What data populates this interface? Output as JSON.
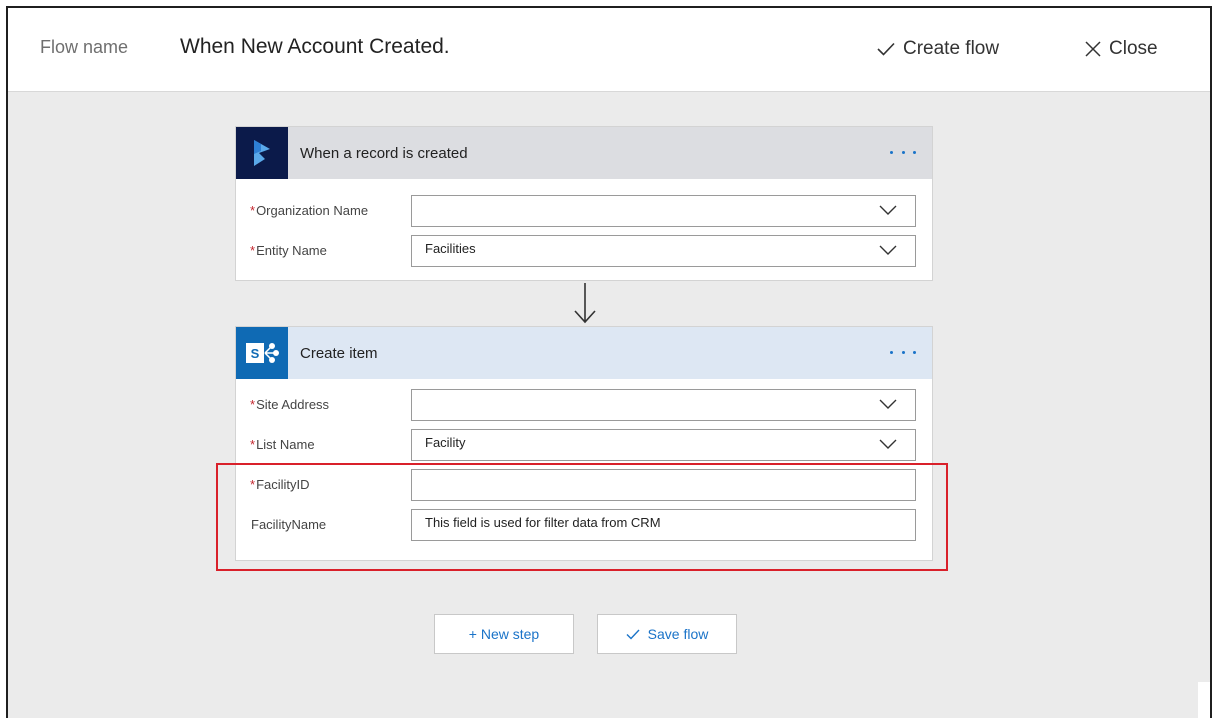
{
  "header": {
    "flow_name_label": "Flow name",
    "flow_name_value": "When New Account Created.",
    "create_flow_label": "Create flow",
    "close_label": "Close"
  },
  "trigger_card": {
    "title": "When a record is created",
    "icon": "dynamics-icon",
    "fields": [
      {
        "label": "Organization Name",
        "required": "*",
        "value": ""
      },
      {
        "label": "Entity Name",
        "required": "*",
        "value": "Facilities"
      }
    ]
  },
  "action_card": {
    "title": "Create item",
    "icon": "sharepoint-icon",
    "fields": [
      {
        "label": "Site Address",
        "required": "*",
        "value": ""
      },
      {
        "label": "List Name",
        "required": "*",
        "value": "Facility"
      },
      {
        "label": "FacilityID",
        "required": "*",
        "value": ""
      },
      {
        "label": "FacilityName",
        "required": "",
        "value": "This field is used for filter data from CRM"
      }
    ]
  },
  "footer": {
    "new_step_label": "+ New step",
    "save_flow_label": "Save flow"
  },
  "colors": {
    "accent": "#1a73c8",
    "required": "#c4262e",
    "highlight": "#d9202a",
    "trigger_icon_bg": "#0b1a4a",
    "action_icon_bg": "#0f6ab4"
  }
}
